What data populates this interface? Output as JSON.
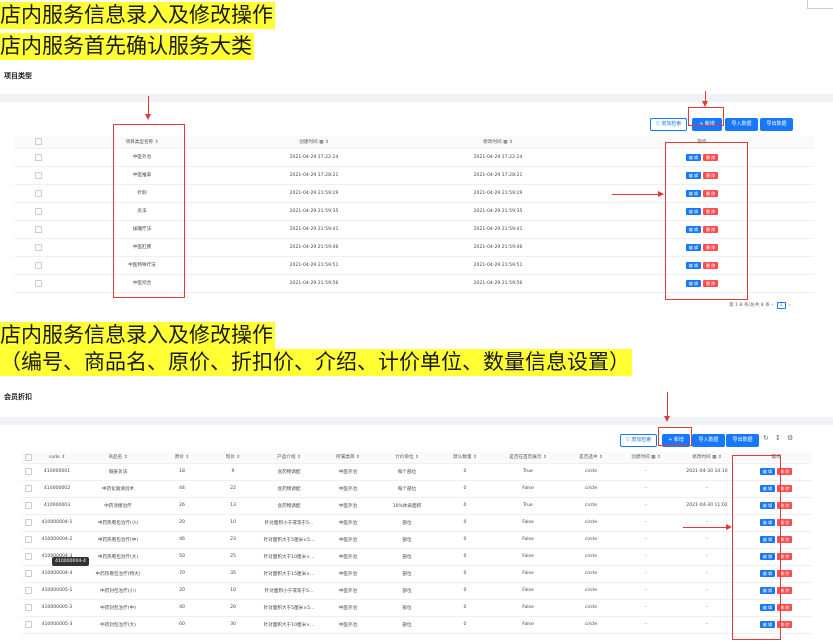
{
  "notes": {
    "line1": "店内服务信息录入及修改操作",
    "line2": "店内服务首先确认服务大类",
    "line3": "店内服务信息录入及修改操作",
    "line4": "（编号、商品名、原价、折扣价、介绍、计价单位、数量信息设置）"
  },
  "section1": {
    "title": "项目类型",
    "toolbar": {
      "search": "▽ 增加检索",
      "new": "+ 新增",
      "import": "导入数据",
      "export": "导出数据"
    },
    "headers": [
      "",
      "项目类型名称 ⇕",
      "创建时间 ▦ ⇕",
      "修改时间 ▦ ⇕",
      "操作"
    ],
    "rows": [
      [
        "中医外治",
        "2021-04-29 17:22:24",
        "2021-04-29 17:22:24"
      ],
      [
        "中医推拿",
        "2021-04-29 17:28:21",
        "2021-04-29 17:28:21"
      ],
      [
        "针刺",
        "2021-04-29 21:59:29",
        "2021-04-29 21:59:29"
      ],
      [
        "灸法",
        "2021-04-29 21:59:35",
        "2021-04-29 21:59:35"
      ],
      [
        "拔罐疗法",
        "2021-04-29 21:59:41",
        "2021-04-29 21:59:41"
      ],
      [
        "中医肛肠",
        "2021-04-29 21:59:46",
        "2021-04-29 21:59:46"
      ],
      [
        "中医特殊疗法",
        "2021-04-29 21:59:51",
        "2021-04-29 21:59:51"
      ],
      [
        "中医综合",
        "2021-04-29 21:59:56",
        "2021-04-29 21:59:56"
      ]
    ],
    "edit_label": "编 辑",
    "delete_label": "删 除",
    "pager_text": "第 1-8 条/总共 8 条",
    "page": "1"
  },
  "section2": {
    "title": "会员折扣",
    "toolbar": {
      "search": "▽ 增加检索",
      "new": "+ 新增",
      "import": "导入数据",
      "export": "导出数据"
    },
    "headers": [
      "",
      "code ⇕",
      "商品名 ⇕",
      "原价 ⇕",
      "现价 ⇕",
      "产品介绍 ⇕",
      "所属类目 ⇕",
      "计价单位 ⇕",
      "默认数量 ⇕",
      "是否在首页展示 ⇕",
      "是否选中 ⇕",
      "创建时间 ▦ ⇕",
      "修改时间 ▦ ⇕",
      "操作"
    ],
    "rows": [
      [
        "410000001",
        "隔姜灸法",
        "18",
        "9",
        "含药物调配",
        "中医外治",
        "每个部位",
        "0",
        "True",
        "circle",
        "-",
        "2021-04-30 10:10"
      ],
      [
        "410000002",
        "中药化腐清创术",
        "44",
        "22",
        "含药物调配",
        "中医外治",
        "每个部位",
        "0",
        "False",
        "circle",
        "-",
        "-"
      ],
      [
        "410000003",
        "中药涂擦治疗",
        "26",
        "13",
        "含药物调配",
        "中医外治",
        "10%体表面积",
        "0",
        "True",
        "circle",
        "-",
        "2021-04-30 11:02"
      ],
      [
        "410000004-1",
        "中药热奄包治疗(小)",
        "20",
        "10",
        "针对面积小于或等于5...",
        "中医外治",
        "部位",
        "0",
        "False",
        "circle",
        "-",
        "-"
      ],
      [
        "410000004-2",
        "中药热奄包治疗(中)",
        "46",
        "23",
        "针对面积大于5厘米×5...",
        "中医外治",
        "部位",
        "0",
        "False",
        "circle",
        "-",
        "-"
      ],
      [
        "410000004-3",
        "中药热奄包治疗(大)",
        "50",
        "25",
        "针对面积大于10厘米×...",
        "中医外治",
        "部位",
        "0",
        "False",
        "circle",
        "-",
        "-"
      ],
      [
        "410000004-4",
        "中药热奄包治疗(特大)",
        "70",
        "35",
        "针对面积大于15厘米×...",
        "中医外治",
        "部位",
        "0",
        "False",
        "circle",
        "-",
        "-"
      ],
      [
        "410000005-1",
        "中药封包治疗(小)",
        "20",
        "10",
        "针对面积小于或等于5...",
        "中医外治",
        "部位",
        "0",
        "False",
        "circle",
        "-",
        "-"
      ],
      [
        "410000005-2",
        "中药封包治疗(中)",
        "40",
        "20",
        "针对面积大于5厘米×5...",
        "中医外治",
        "部位",
        "0",
        "False",
        "circle",
        "-",
        "-"
      ],
      [
        "410000005-3",
        "中药封包治疗(大)",
        "60",
        "30",
        "针对面积大于10厘米×...",
        "中医外治",
        "部位",
        "0",
        "False",
        "circle",
        "-",
        "-"
      ]
    ],
    "tooltip": "410000004-4",
    "edit_label": "编 辑",
    "delete_label": "删 除",
    "icons": [
      "reload-icon",
      "column-height-icon",
      "setting-icon"
    ]
  },
  "colors": {
    "highlight": "#ffff33",
    "primary": "#1677ff",
    "danger": "#ff4d4f",
    "annotation": "#e53935"
  }
}
